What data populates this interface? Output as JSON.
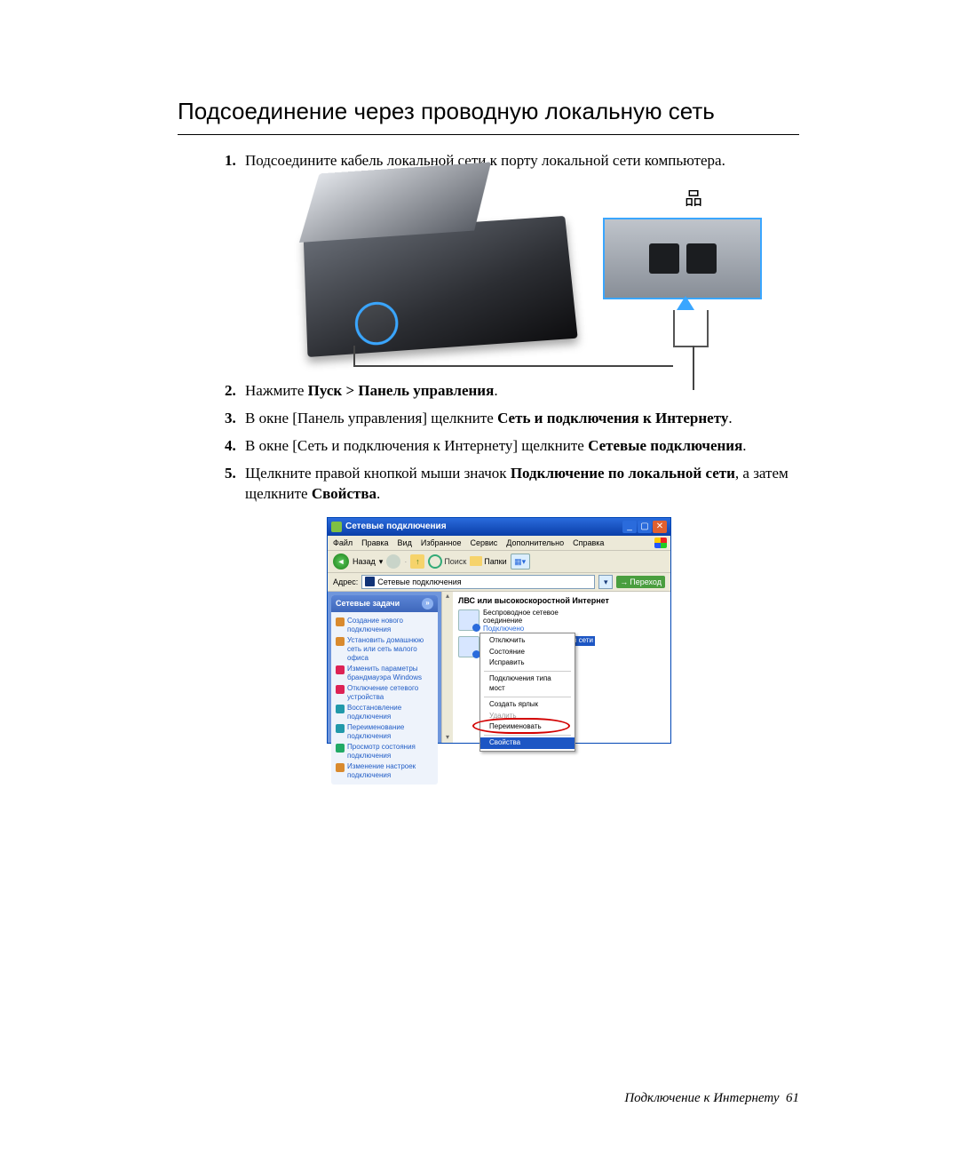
{
  "title": "Подсоединение через проводную локальную сеть",
  "steps": {
    "s1": "Подсоедините кабель локальной сети к порту локальной сети компьютера.",
    "s2_pre": "Нажмите ",
    "s2_bold": "Пуск > Панель управления",
    "s2_post": ".",
    "s3_pre": "В окне [Панель управления] щелкните ",
    "s3_bold": "Сеть и подключения к Интернету",
    "s3_post": ".",
    "s4_pre": "В окне [Сеть и подключения к Интернету] щелкните ",
    "s4_bold": "Сетевые подключения",
    "s4_post": ".",
    "s5_pre": "Щелкните правой кнопкой мыши значок ",
    "s5_bold": "Подключение по локальной сети",
    "s5_mid": ", а затем щелкните ",
    "s5_bold2": "Свойства",
    "s5_post": "."
  },
  "xp": {
    "title": "Сетевые подключения",
    "menu": [
      "Файл",
      "Правка",
      "Вид",
      "Избранное",
      "Сервис",
      "Дополнительно",
      "Справка"
    ],
    "toolbar": {
      "back": "Назад",
      "search": "Поиск",
      "folders": "Папки"
    },
    "address_label": "Адрес:",
    "address_value": "Сетевые подключения",
    "go": "Переход",
    "task_header": "Сетевые задачи",
    "tasks": [
      "Создание нового подключения",
      "Установить домашнюю сеть или сеть малого офиса",
      "Изменить параметры брандмауэра Windows",
      "Отключение сетевого устройства",
      "Восстановление подключения",
      "Переименование подключения",
      "Просмотр состояния подключения",
      "Изменение настроек подключения"
    ],
    "category": "ЛВС или высокоскоростной Интернет",
    "item1_l1": "Беспроводное сетевое",
    "item1_l2": "соединение",
    "item1_l3": "Подключено",
    "item2_sel": "Подключение по локальной сети",
    "context": [
      "Отключить",
      "Состояние",
      "Исправить",
      "Подключения типа мост",
      "Создать ярлык",
      "Удалить",
      "Переименовать",
      "Свойства"
    ]
  },
  "footer_text": "Подключение к Интернету",
  "footer_page": "61"
}
